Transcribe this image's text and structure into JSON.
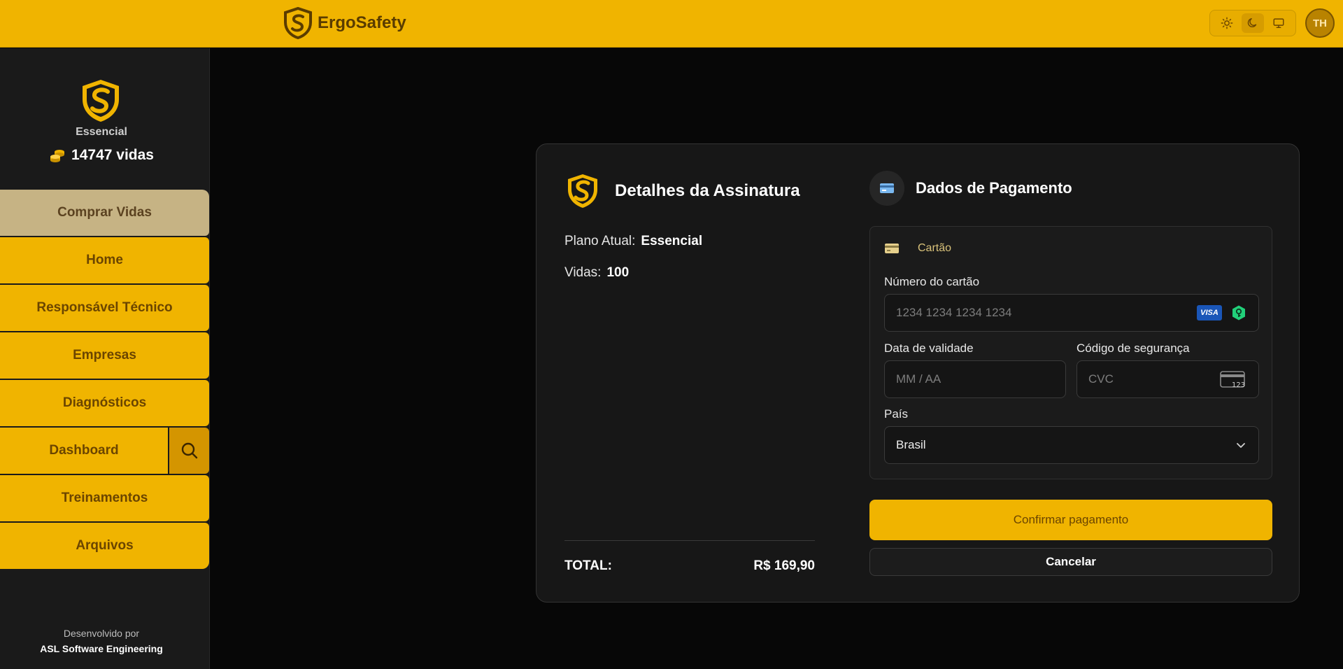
{
  "brand": {
    "name": "ErgoSafety",
    "color": "#f0b400"
  },
  "user": {
    "initials": "TH"
  },
  "theme": {
    "options": [
      "sun-icon",
      "moon-icon",
      "monitor-icon"
    ],
    "active": "moon-icon"
  },
  "sidebar": {
    "plan": "Essencial",
    "lives": "14747 vidas",
    "items": [
      {
        "label": "Comprar Vidas"
      },
      {
        "label": "Home"
      },
      {
        "label": "Responsável Técnico"
      },
      {
        "label": "Empresas"
      },
      {
        "label": "Diagnósticos"
      },
      {
        "label": "Dashboard"
      },
      {
        "label": "Treinamentos"
      },
      {
        "label": "Arquivos"
      }
    ],
    "footer_line1": "Desenvolvido por",
    "footer_line2": "ASL Software Engineering"
  },
  "subscription": {
    "title": "Detalhes da Assinatura",
    "plan_label": "Plano Atual:",
    "plan_value": "Essencial",
    "lives_label": "Vidas:",
    "lives_value": "100",
    "total_label": "TOTAL:",
    "total_value": "R$ 169,90"
  },
  "payment": {
    "title": "Dados de Pagamento",
    "tab_label": "Cartão",
    "card_number_label": "Número do cartão",
    "card_number_placeholder": "1234 1234 1234 1234",
    "card_brand": "VISA",
    "expiry_label": "Data de validade",
    "expiry_placeholder": "MM / AA",
    "cvc_label": "Código de segurança",
    "cvc_placeholder": "CVC",
    "country_label": "País",
    "country_value": "Brasil",
    "confirm_label": "Confirmar pagamento",
    "cancel_label": "Cancelar"
  }
}
